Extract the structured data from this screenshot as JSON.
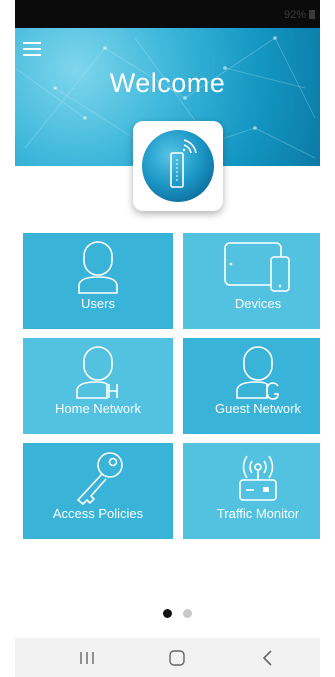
{
  "status_bar": {
    "battery": "92%"
  },
  "header": {
    "title": "Welcome"
  },
  "tiles": [
    {
      "label": "Users",
      "icon": "user-icon"
    },
    {
      "label": "Devices",
      "icon": "devices-icon"
    },
    {
      "label": "Home Network",
      "icon": "home-network-user-icon"
    },
    {
      "label": "Guest Network",
      "icon": "guest-network-user-icon"
    },
    {
      "label": "Access Policies",
      "icon": "key-icon"
    },
    {
      "label": "Traffic Monitor",
      "icon": "router-icon"
    }
  ],
  "pager": {
    "pages": 2,
    "current": 1
  },
  "nav_bar": {
    "icons": [
      "recent-apps-icon",
      "home-icon",
      "back-icon"
    ]
  },
  "colors": {
    "tile": "#39b4d8",
    "tile_light": "#52c2e0",
    "header": "#1497c3"
  }
}
